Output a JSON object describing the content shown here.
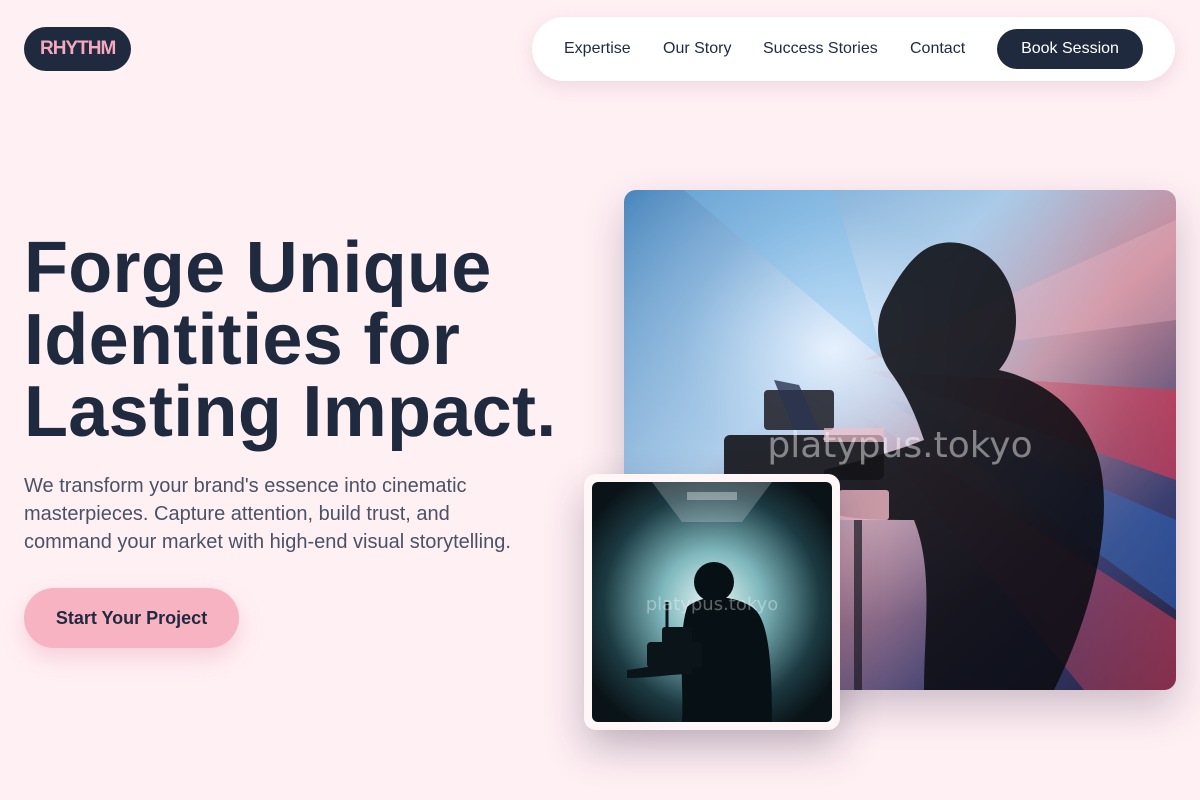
{
  "brand": {
    "logo_text": "RHYTHM"
  },
  "nav": {
    "links": [
      "Expertise",
      "Our Story",
      "Success Stories",
      "Contact"
    ],
    "cta_label": "Book Session"
  },
  "hero": {
    "headline_lines": [
      "Forge Unique",
      "Identities for",
      "Lasting Impact."
    ],
    "subtext": "We transform your brand's essence into cinematic masterpieces. Capture attention, build trust, and command your market with high-end visual storytelling.",
    "cta_label": "Start Your Project"
  },
  "images": {
    "main_photo_icon": "videographer-silhouette-light-beams",
    "small_photo_icon": "camera-operator-silhouette-backlit",
    "watermark": "platypus.tokyo"
  },
  "colors": {
    "background": "#fff0f4",
    "navy": "#1f2a3f",
    "pink_accent": "#f8b3c3",
    "logo_text": "#f6a8bd"
  }
}
